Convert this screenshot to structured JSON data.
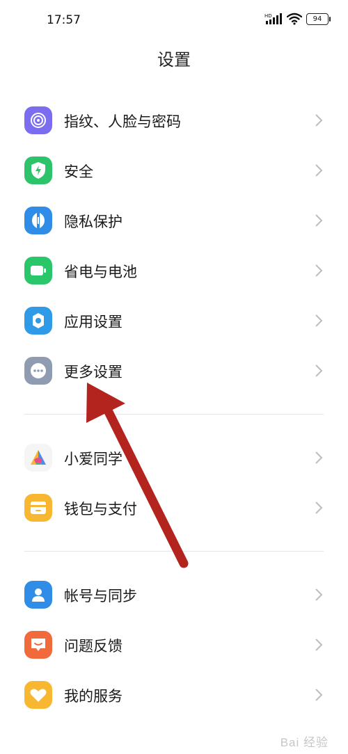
{
  "status": {
    "time": "17:57",
    "network_label": "HD",
    "battery": "94"
  },
  "page": {
    "title": "设置"
  },
  "groups": [
    {
      "items": [
        {
          "label": "指纹、人脸与密码",
          "icon": "fingerprint-icon",
          "color": "#7b6cf0"
        },
        {
          "label": "安全",
          "icon": "shield-bolt-icon",
          "color": "#2cc36b"
        },
        {
          "label": "隐私保护",
          "icon": "privacy-icon",
          "color": "#2f8de8"
        },
        {
          "label": "省电与电池",
          "icon": "battery-icon",
          "color": "#29c66a"
        },
        {
          "label": "应用设置",
          "icon": "gear-icon",
          "color": "#2f9be8"
        },
        {
          "label": "更多设置",
          "icon": "more-icon",
          "color": "#8e9bb0"
        }
      ]
    },
    {
      "items": [
        {
          "label": "小爱同学",
          "icon": "xiaoai-icon",
          "color": "#f5f5f5"
        },
        {
          "label": "钱包与支付",
          "icon": "wallet-icon",
          "color": "#f7b731"
        }
      ]
    },
    {
      "items": [
        {
          "label": "帐号与同步",
          "icon": "account-icon",
          "color": "#2f8de8"
        },
        {
          "label": "问题反馈",
          "icon": "feedback-icon",
          "color": "#f06a3c"
        },
        {
          "label": "我的服务",
          "icon": "heart-icon",
          "color": "#f7b731"
        }
      ]
    }
  ],
  "annotation": {
    "color": "#b3241f"
  },
  "watermark": {
    "text": "Bai 经验"
  }
}
